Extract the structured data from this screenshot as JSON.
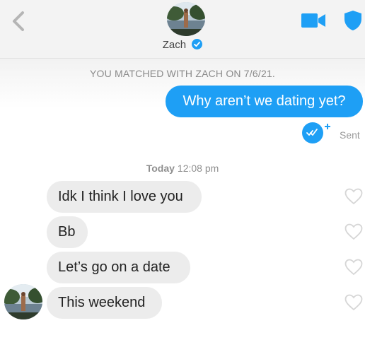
{
  "header": {
    "contact_name": "Zach",
    "verified": true,
    "accent_color": "#1e9ff5"
  },
  "icons": {
    "back": "chevron-left-icon",
    "video": "video-camera-icon",
    "safety": "shield-icon",
    "verified": "verified-badge-icon",
    "read": "double-check-icon",
    "like": "heart-outline-icon"
  },
  "conversation": {
    "matched_banner": "YOU MATCHED WITH ZACH ON 7/6/21.",
    "outgoing": [
      {
        "text": "Why aren’t we dating yet?",
        "status": "Sent"
      }
    ],
    "divider": {
      "day": "Today",
      "time": "12:08 pm"
    },
    "incoming": [
      {
        "text": "Idk I think I love you"
      },
      {
        "text": "Bb"
      },
      {
        "text": "Let’s go on a date"
      },
      {
        "text": "This weekend"
      }
    ]
  }
}
